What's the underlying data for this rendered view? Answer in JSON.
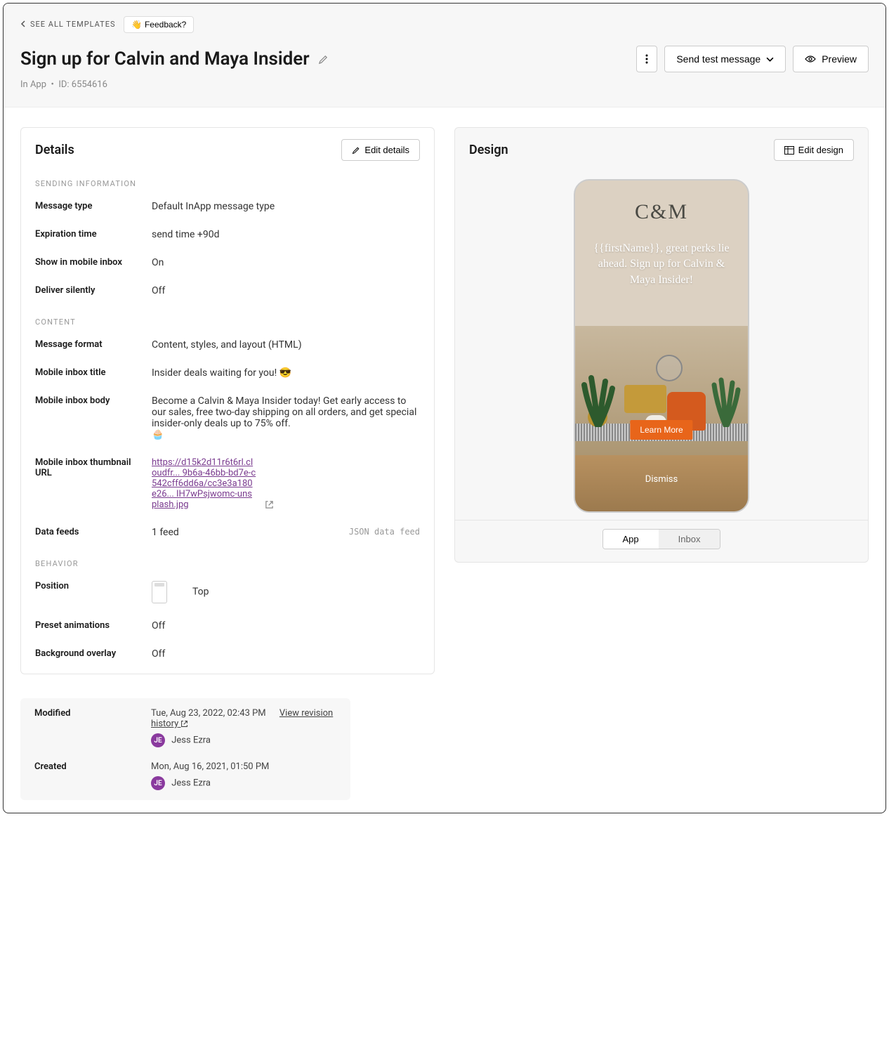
{
  "header": {
    "back_label": "SEE ALL TEMPLATES",
    "feedback_label": "Feedback?",
    "title": "Sign up for Calvin and Maya Insider",
    "meta_channel": "In App",
    "meta_id_label": "ID: 6554616",
    "send_test_label": "Send test message",
    "preview_label": "Preview"
  },
  "details": {
    "title": "Details",
    "edit_label": "Edit details",
    "sections": {
      "sending": "SENDING INFORMATION",
      "content": "CONTENT",
      "behavior": "BEHAVIOR"
    },
    "fields": {
      "message_type": {
        "label": "Message type",
        "value": "Default InApp message type"
      },
      "expiration": {
        "label": "Expiration time",
        "value": "send time +90d"
      },
      "inbox_show": {
        "label": "Show in mobile inbox",
        "value": "On"
      },
      "deliver_silently": {
        "label": "Deliver silently",
        "value": "Off"
      },
      "message_format": {
        "label": "Message format",
        "value": "Content, styles, and layout (HTML)"
      },
      "inbox_title": {
        "label": "Mobile inbox title",
        "value": "Insider deals waiting for you! 😎"
      },
      "inbox_body": {
        "label": "Mobile inbox body",
        "value": "Become a Calvin & Maya Insider today! Get early access to our sales, free two-day shipping on all orders, and get special insider-only deals up to 75% off.\n🧁"
      },
      "thumbnail": {
        "label": "Mobile inbox thumbnail URL",
        "value": "https://d15k2d11r6t6rl.cloudfr... 9b6a-46bb-bd7e-c542cff6dd6a/cc3e3a180e26... IH7wPsjwomc-unsplash.jpg"
      },
      "data_feeds": {
        "label": "Data feeds",
        "value": "1 feed",
        "extra": "JSON data feed"
      },
      "position": {
        "label": "Position",
        "value": "Top"
      },
      "animations": {
        "label": "Preset animations",
        "value": "Off"
      },
      "overlay": {
        "label": "Background overlay",
        "value": "Off"
      }
    }
  },
  "design": {
    "title": "Design",
    "edit_label": "Edit design",
    "phone": {
      "logo": "C&M",
      "headline": "{{firstName}}, great perks lie ahead. Sign up for Calvin & Maya Insider!",
      "cta": "Learn More",
      "dismiss": "Dismiss"
    },
    "tabs": {
      "app": "App",
      "inbox": "Inbox"
    }
  },
  "footer": {
    "modified": {
      "label": "Modified",
      "date": "Tue, Aug 23, 2022, 02:43 PM",
      "link": "View revision history",
      "user": "Jess Ezra",
      "initials": "JE"
    },
    "created": {
      "label": "Created",
      "date": "Mon, Aug 16, 2021, 01:50 PM",
      "user": "Jess Ezra",
      "initials": "JE"
    }
  }
}
